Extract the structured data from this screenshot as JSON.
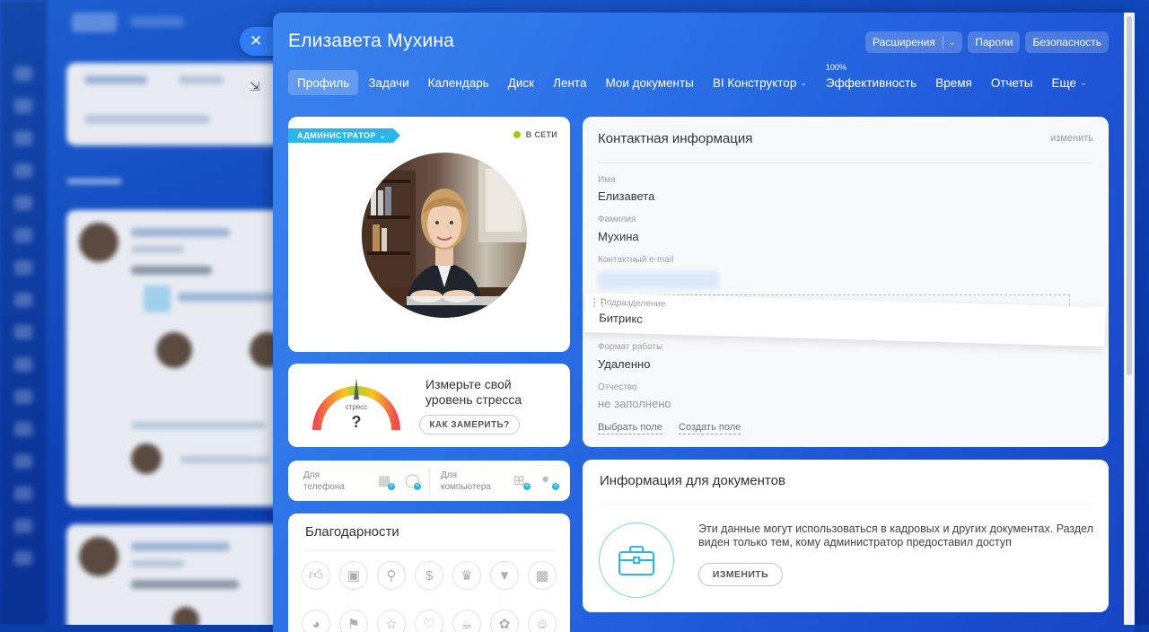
{
  "header": {
    "title": "Елизавета Мухина",
    "buttons": {
      "extensions": "Расширения",
      "passwords": "Пароли",
      "security": "Безопасность"
    }
  },
  "tabs": [
    {
      "label": "Профиль"
    },
    {
      "label": "Задачи"
    },
    {
      "label": "Календарь"
    },
    {
      "label": "Диск"
    },
    {
      "label": "Лента"
    },
    {
      "label": "Мои документы"
    },
    {
      "label": "BI Конструктор"
    },
    {
      "label": "Эффективность",
      "badge": "100%"
    },
    {
      "label": "Время"
    },
    {
      "label": "Отчеты"
    },
    {
      "label": "Еще"
    }
  ],
  "profile": {
    "role": "АДМИНИСТРАТОР",
    "status": "В СЕТИ"
  },
  "stress": {
    "gauge_label": "стресс",
    "gauge_value": "?",
    "text": "Измерьте свой уровень стресса",
    "button": "КАК ЗАМЕРИТЬ?"
  },
  "apps": {
    "phone_label": "Для телефона",
    "computer_label": "Для компьютера"
  },
  "thanks": {
    "title": "Благодарности"
  },
  "contact": {
    "title": "Контактная информация",
    "edit": "изменить",
    "fields": {
      "first_name": {
        "label": "Имя",
        "value": "Елизавета"
      },
      "last_name": {
        "label": "Фамилия",
        "value": "Мухина"
      },
      "email": {
        "label": "Контактный e-mail"
      },
      "department": {
        "label": "Подразделение",
        "value": "Битрикс"
      },
      "work_format": {
        "label": "Формат работы",
        "value": "Удаленно"
      },
      "patronymic": {
        "label": "Отчество",
        "value": "не заполнено"
      }
    },
    "choose_field": "Выбрать поле",
    "create_field": "Создать поле"
  },
  "documents": {
    "title": "Информация для документов",
    "text": "Эти данные могут использоваться в кадровых и других документах. Раздел виден только тем, кому администратор предоставил доступ",
    "button": "ИЗМЕНИТЬ"
  },
  "colors": {
    "accent": "#2f7cf6",
    "badge": "#29b6e8",
    "online": "#9dcf00"
  }
}
